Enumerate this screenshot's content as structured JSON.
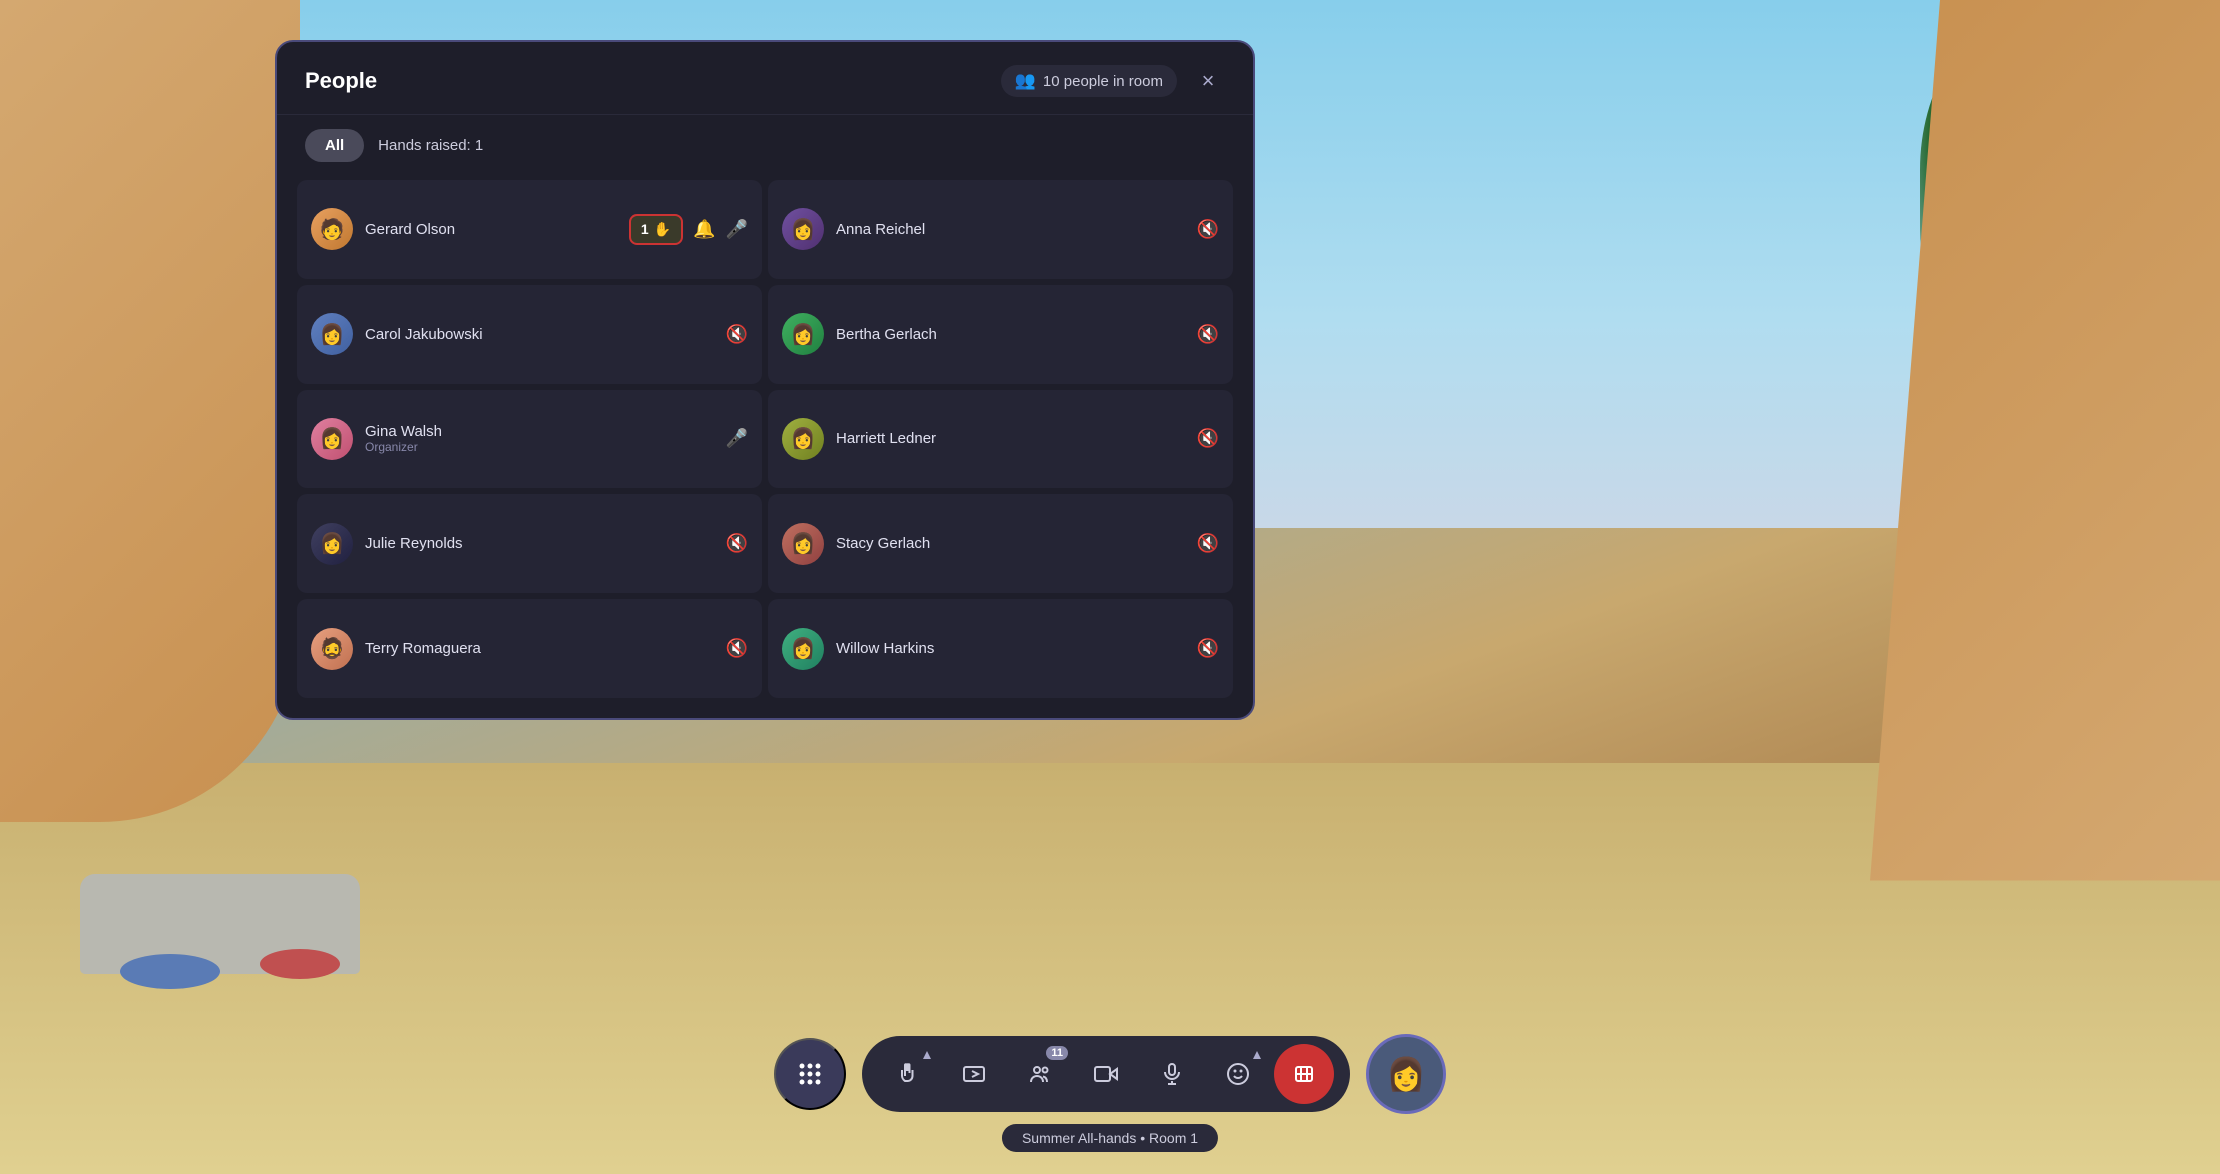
{
  "background": {
    "color": "#6a9bb5"
  },
  "panel": {
    "title": "People",
    "people_count_label": "10 people in room",
    "close_label": "×"
  },
  "tabs": [
    {
      "id": "all",
      "label": "All",
      "active": true
    },
    {
      "id": "hands",
      "label": "Hands raised: 1",
      "active": false
    }
  ],
  "people": [
    {
      "id": "gerard",
      "name": "Gerard Olson",
      "role": "",
      "avatar_emoji": "🧑",
      "avatar_class": "av-gerard",
      "has_hand": true,
      "hand_count": "1",
      "has_bell": true,
      "has_mic": true,
      "mic_active": false,
      "mic_off": false,
      "column": 0
    },
    {
      "id": "anna",
      "name": "Anna Reichel",
      "role": "",
      "avatar_emoji": "👩",
      "avatar_class": "av-anna",
      "has_hand": false,
      "has_bell": false,
      "has_mic": false,
      "mic_active": false,
      "mic_off": true,
      "column": 1
    },
    {
      "id": "carol",
      "name": "Carol Jakubowski",
      "role": "",
      "avatar_emoji": "👩",
      "avatar_class": "av-carol",
      "has_hand": false,
      "has_bell": false,
      "has_mic": false,
      "mic_active": false,
      "mic_off": true,
      "column": 0
    },
    {
      "id": "bertha",
      "name": "Bertha Gerlach",
      "role": "",
      "avatar_emoji": "👩",
      "avatar_class": "av-bertha",
      "has_hand": false,
      "has_bell": false,
      "has_mic": false,
      "mic_active": false,
      "mic_off": true,
      "column": 1
    },
    {
      "id": "gina",
      "name": "Gina Walsh",
      "role": "Organizer",
      "avatar_emoji": "👩",
      "avatar_class": "av-gina",
      "has_hand": false,
      "has_bell": false,
      "has_mic": true,
      "mic_active": true,
      "mic_off": false,
      "column": 0
    },
    {
      "id": "harriett",
      "name": "Harriett Ledner",
      "role": "",
      "avatar_emoji": "👩",
      "avatar_class": "av-harriett",
      "has_hand": false,
      "has_bell": false,
      "has_mic": false,
      "mic_active": false,
      "mic_off": true,
      "column": 1
    },
    {
      "id": "julie",
      "name": "Julie Reynolds",
      "role": "",
      "avatar_emoji": "👩",
      "avatar_class": "av-julie",
      "has_hand": false,
      "has_bell": false,
      "has_mic": false,
      "mic_active": false,
      "mic_off": true,
      "column": 0
    },
    {
      "id": "stacy",
      "name": "Stacy Gerlach",
      "role": "",
      "avatar_emoji": "👩",
      "avatar_class": "av-stacy",
      "has_hand": false,
      "has_bell": false,
      "has_mic": false,
      "mic_active": false,
      "mic_off": true,
      "column": 1
    },
    {
      "id": "terry",
      "name": "Terry Romaguera",
      "role": "",
      "avatar_emoji": "🧔",
      "avatar_class": "av-terry",
      "has_hand": false,
      "has_bell": false,
      "has_mic": false,
      "mic_active": false,
      "mic_off": true,
      "column": 0
    },
    {
      "id": "willow",
      "name": "Willow Harkins",
      "role": "",
      "avatar_emoji": "👩",
      "avatar_class": "av-willow",
      "has_hand": false,
      "has_bell": false,
      "has_mic": false,
      "mic_active": false,
      "mic_off": true,
      "column": 1
    }
  ],
  "toolbar": {
    "dots_label": "⠿",
    "raise_label": "⬆",
    "media_label": "🎬",
    "people_label": "👤",
    "people_count": "11",
    "camera_label": "📷",
    "mic_label": "🎤",
    "emoji_label": "😊",
    "end_label": "📵"
  },
  "room_label": "Summer All-hands • Room 1"
}
